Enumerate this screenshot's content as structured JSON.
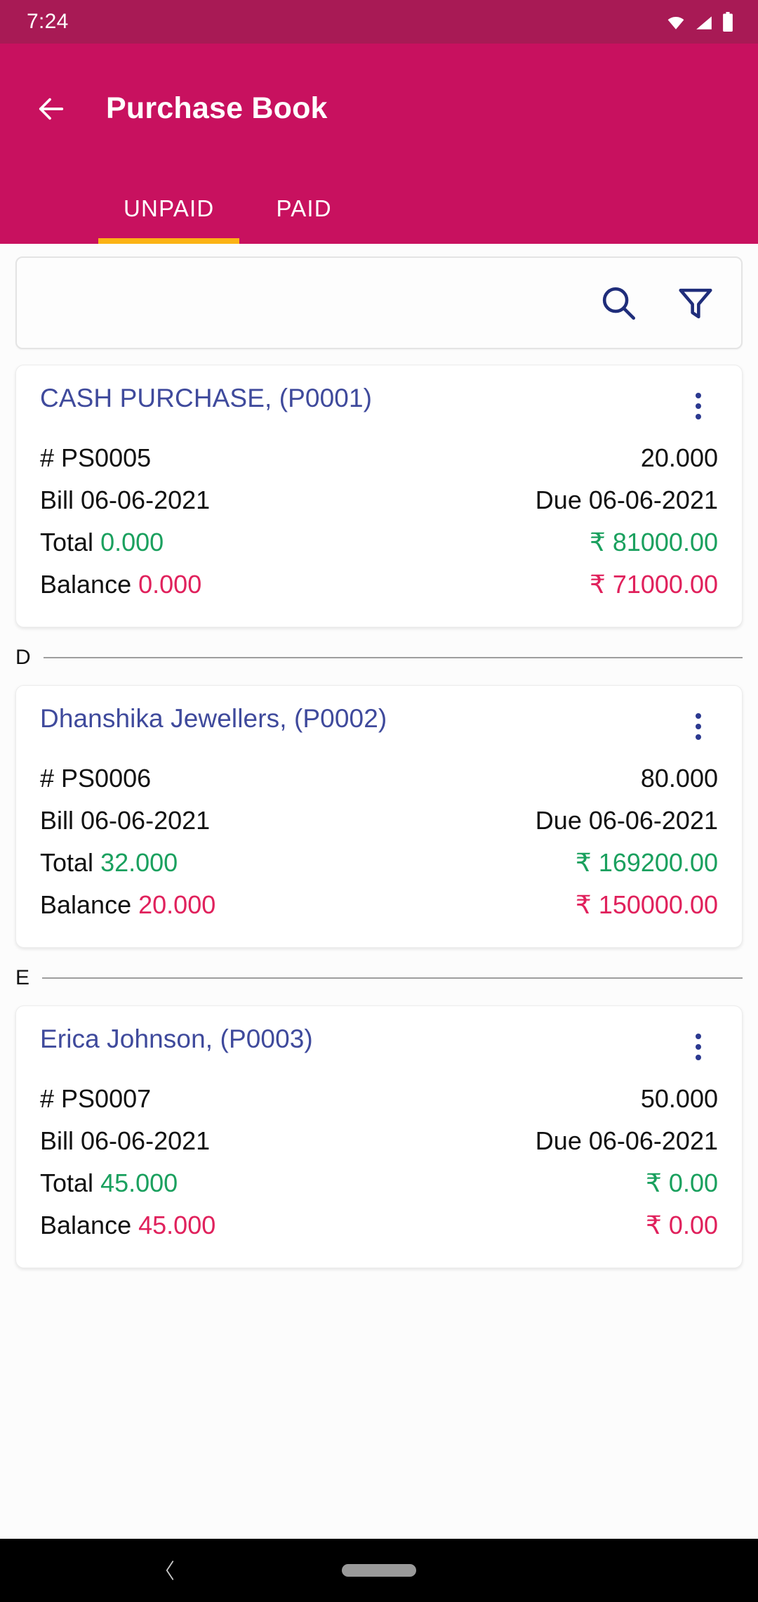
{
  "status": {
    "time": "7:24",
    "icons": [
      "wifi-icon",
      "signal-icon",
      "battery-icon"
    ]
  },
  "appbar": {
    "back_label": "back-arrow",
    "title": "Purchase Book",
    "bg": "#c8115f"
  },
  "tabs": {
    "items": [
      {
        "label": "UNPAID",
        "active": true
      },
      {
        "label": "PAID",
        "active": false
      }
    ],
    "indicator_color": "#fbb314"
  },
  "search": {
    "value": "",
    "placeholder": "",
    "search_icon": "search-icon",
    "filter_icon": "filter-icon",
    "icon_color": "#1f2d7a"
  },
  "labels": {
    "bill": "Bill",
    "due": "Due",
    "total": "Total",
    "balance": "Balance",
    "hash": "#"
  },
  "colors": {
    "party": "#3f4a9c",
    "positive": "#1aa05e",
    "negative": "#e0215c"
  },
  "entries": [
    {
      "party": "CASH PURCHASE, (P0001)",
      "voucher": "# PS0005",
      "qty": "20.000",
      "bill_date": "Bill 06-06-2021",
      "due_date": "Due 06-06-2021",
      "total_label": "Total",
      "total_qty": "0.000",
      "total_amount": "₹ 81000.00",
      "balance_label": "Balance",
      "balance_qty": "0.000",
      "balance_amount": "₹ 71000.00"
    },
    {
      "party": "Dhanshika Jewellers, (P0002)",
      "voucher": "# PS0006",
      "qty": "80.000",
      "bill_date": "Bill 06-06-2021",
      "due_date": "Due 06-06-2021",
      "total_label": "Total",
      "total_qty": "32.000",
      "total_amount": "₹ 169200.00",
      "balance_label": "Balance",
      "balance_qty": "20.000",
      "balance_amount": "₹ 150000.00"
    },
    {
      "party": "Erica Johnson, (P0003)",
      "voucher": "# PS0007",
      "qty": "50.000",
      "bill_date": "Bill 06-06-2021",
      "due_date": "Due 06-06-2021",
      "total_label": "Total",
      "total_qty": "45.000",
      "total_amount": "₹ 0.00",
      "balance_label": "Balance",
      "balance_qty": "45.000",
      "balance_amount": "₹ 0.00"
    }
  ],
  "separators": [
    {
      "letter": "D"
    },
    {
      "letter": "E"
    }
  ],
  "navbar": {
    "back": "nav-back-icon",
    "home_pill": "home-pill"
  }
}
